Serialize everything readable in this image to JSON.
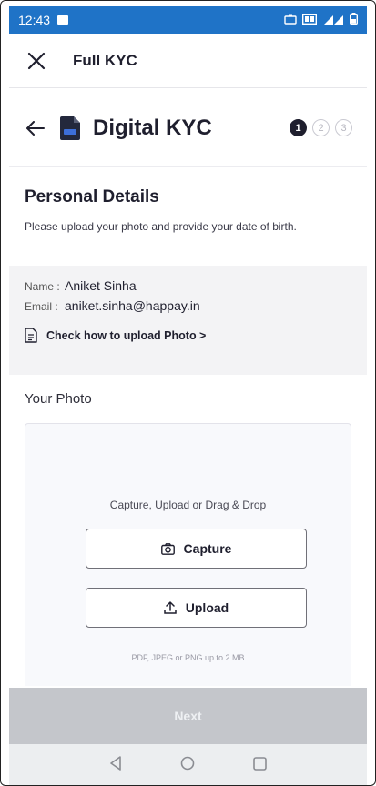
{
  "statusbar": {
    "time": "12:43"
  },
  "appbar": {
    "title": "Full KYC"
  },
  "kyc": {
    "title": "Digital KYC",
    "steps": [
      "1",
      "2",
      "3"
    ],
    "active_step": 1
  },
  "personal_details": {
    "heading": "Personal Details",
    "subtitle": "Please upload your photo and provide your date of birth."
  },
  "user": {
    "name_label": "Name :",
    "name": "Aniket Sinha",
    "email_label": "Email :",
    "email": "aniket.sinha@happay.in",
    "link_text": "Check how to upload Photo >"
  },
  "photo": {
    "heading": "Your Photo",
    "hint": "Capture, Upload or Drag & Drop",
    "capture_label": "Capture",
    "upload_label": "Upload",
    "limits": "PDF, JPEG or PNG up to 2 MB"
  },
  "footer": {
    "next_label": "Next"
  },
  "colors": {
    "statusbar": "#1f73c7",
    "accent_dark": "#1f1f2e",
    "next_disabled": "#c4c6cb"
  }
}
